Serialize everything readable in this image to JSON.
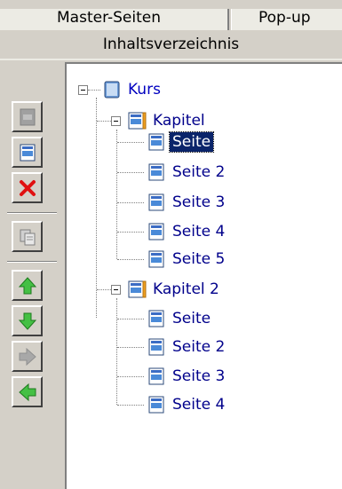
{
  "tabs": {
    "master": "Master-Seiten",
    "popup": "Pop-up"
  },
  "panel": {
    "title": "Inhaltsverzeichnis"
  },
  "toolbar": {
    "buttons": [
      {
        "icon": "page-disabled-icon"
      },
      {
        "icon": "new-page-icon"
      },
      {
        "icon": "delete-icon"
      },
      {
        "icon": "copy-icon"
      },
      {
        "icon": "move-up-icon"
      },
      {
        "icon": "move-down-icon"
      },
      {
        "icon": "indent-right-icon"
      },
      {
        "icon": "outdent-left-icon"
      }
    ]
  },
  "tree": {
    "root": "Kurs",
    "chapters": [
      {
        "label": "Kapitel",
        "pages": [
          "Seite",
          "Seite 2",
          "Seite 3",
          "Seite 4",
          "Seite 5"
        ]
      },
      {
        "label": "Kapitel 2",
        "pages": [
          "Seite",
          "Seite 2",
          "Seite 3",
          "Seite 4"
        ]
      }
    ],
    "selected": "Seite"
  },
  "colors": {
    "selection": "#0a246a",
    "link_text": "#00008b",
    "panel_bg": "#d4d0c8"
  }
}
